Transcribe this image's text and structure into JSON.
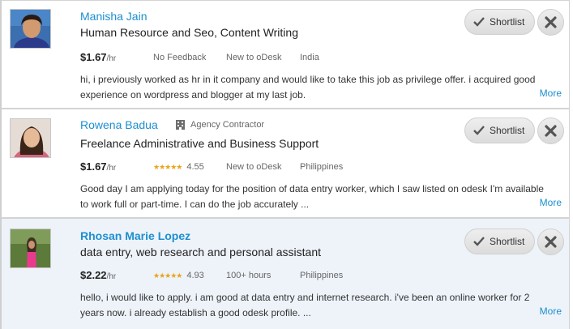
{
  "colors": {
    "link": "#1d8fcf",
    "star": "#e8a41c",
    "highlight_bg": "#eef3fa"
  },
  "freelancers": [
    {
      "name": "Manisha Jain",
      "avatar_icon": "profile-photo",
      "title": "Human Resource and Seo, Content Writing",
      "rate": "$1.67",
      "rate_unit": "/hr",
      "feedback": "No Feedback",
      "hours": "New to oDesk",
      "country": "India",
      "cover_letter": "hi, i previously worked as hr in it company and would like to take this job as privilege offer. i acquired good experience on wordpress and blogger at my last job.",
      "more_label": "More",
      "shortlist_label": "Shortlist"
    },
    {
      "name": "Rowena Badua",
      "agency_label": "Agency Contractor",
      "avatar_icon": "profile-photo",
      "title": "Freelance Administrative and Business Support",
      "rate": "$1.67",
      "rate_unit": "/hr",
      "rating": "4.55",
      "rating_stars": 4.55,
      "hours": "New to oDesk",
      "country": "Philippines",
      "cover_letter": "Good day I am applying today for the position of data entry worker, which I saw listed on odesk I'm available to work full or part-time. I can do the job accurately ...",
      "more_label": "More",
      "shortlist_label": "Shortlist"
    },
    {
      "name": "Rhosan Marie Lopez",
      "avatar_icon": "profile-photo",
      "title": "data entry, web research and personal assistant",
      "rate": "$2.22",
      "rate_unit": "/hr",
      "rating": "4.93",
      "rating_stars": 4.93,
      "hours": "100+ hours",
      "country": "Philippines",
      "cover_letter": "hello, i would like to apply. i am good at data entry and internet research. i've been an online worker for 2 years now. i already establish a good odesk profile. ...",
      "more_label": "More",
      "shortlist_label": "Shortlist"
    }
  ]
}
